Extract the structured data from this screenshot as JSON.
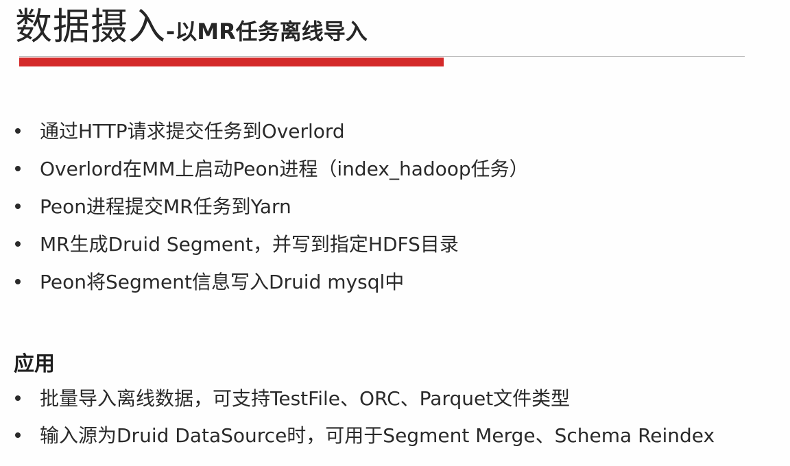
{
  "title": {
    "main": "数据摄入",
    "sub": "-以MR任务离线导入"
  },
  "bullets_top": [
    "通过HTTP请求提交任务到Overlord",
    "Overlord在MM上启动Peon进程（index_hadoop任务）",
    "Peon进程提交MR任务到Yarn",
    "MR生成Druid Segment，并写到指定HDFS目录",
    "Peon将Segment信息写入Druid mysql中"
  ],
  "section": {
    "heading": "应用",
    "bullets": [
      "批量导入离线数据，可支持TestFile、ORC、Parquet文件类型",
      "输入源为Druid DataSource时，可用于Segment Merge、Schema Reindex"
    ]
  },
  "colors": {
    "accent": "#d42a2a",
    "rule": "#bdbdbd",
    "text": "#2a2a2a"
  }
}
